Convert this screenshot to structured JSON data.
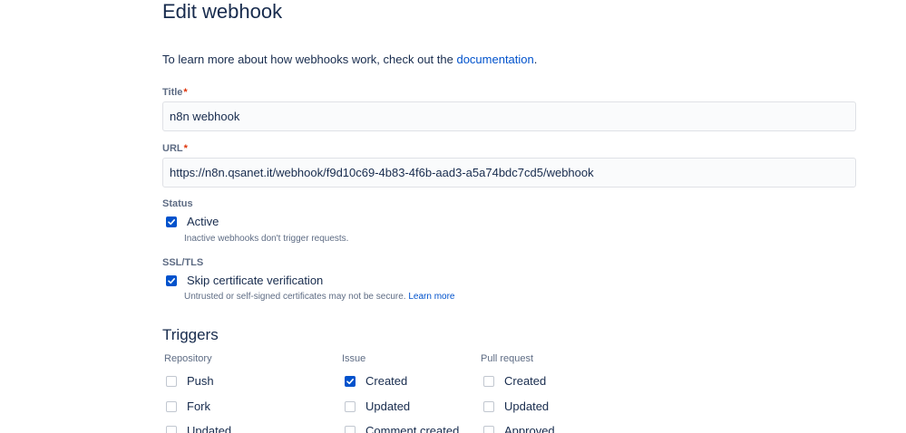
{
  "page": {
    "title": "Edit webhook",
    "intro_text": "To learn more about how webhooks work, check out the ",
    "intro_link": "documentation",
    "intro_end": "."
  },
  "form": {
    "title_label": "Title",
    "required_mark": "*",
    "title_value": "n8n webhook",
    "url_label": "URL",
    "url_value": "https://n8n.qsanet.it/webhook/f9d10c69-4b83-4f6b-aad3-a5a74bdc7cd5/webhook",
    "status_label": "Status",
    "active_label": "Active",
    "active_checked": true,
    "active_help": "Inactive webhooks don't trigger requests.",
    "ssl_label": "SSL/TLS",
    "skip_label": "Skip certificate verification",
    "skip_checked": true,
    "skip_help": "Untrusted or self-signed certificates may not be secure. ",
    "skip_help_link": "Learn more"
  },
  "triggers": {
    "title": "Triggers",
    "columns": [
      {
        "heading": "Repository",
        "items": [
          {
            "label": "Push",
            "checked": false
          },
          {
            "label": "Fork",
            "checked": false
          },
          {
            "label": "Updated",
            "checked": false
          }
        ]
      },
      {
        "heading": "Issue",
        "items": [
          {
            "label": "Created",
            "checked": true
          },
          {
            "label": "Updated",
            "checked": false
          },
          {
            "label": "Comment created",
            "checked": false
          }
        ]
      },
      {
        "heading": "Pull request",
        "items": [
          {
            "label": "Created",
            "checked": false
          },
          {
            "label": "Updated",
            "checked": false
          },
          {
            "label": "Approved",
            "checked": false
          }
        ]
      }
    ]
  },
  "colors": {
    "accent": "#0052cc",
    "text": "#172b4d",
    "subtle": "#5e6c84",
    "required": "#de350b"
  }
}
